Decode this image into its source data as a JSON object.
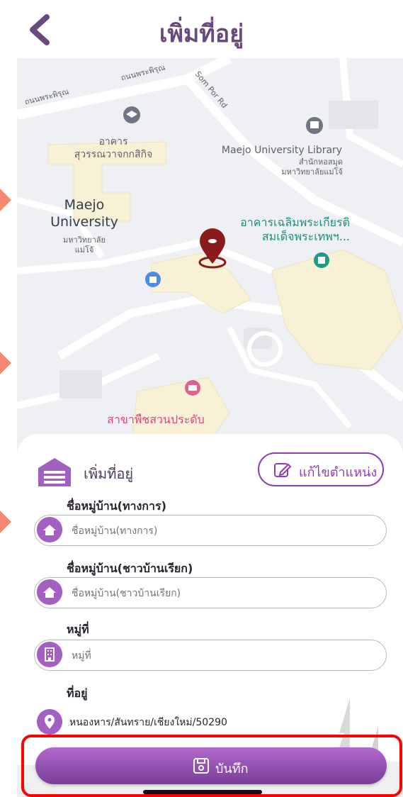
{
  "header": {
    "title": "เพิ่มที่อยู่"
  },
  "map": {
    "labels": {
      "road_1": "ถนนพระพิรุณ",
      "road_2": "ถนนพระพิรุณ",
      "road_3": "Som Por Rd",
      "building_1": "อาคาร\nสุวรรณวาจกกสิกิจ",
      "library": "Maejo University Library",
      "library_th": "สำนักหอสมุด\nมหาวิทยาลัยแม่โจ้",
      "university": "Maejo\nUniversity",
      "university_th": "มหาวิทยาลัย\nแม่โจ้",
      "building_2": "อาคารเฉลิมพระเกียรติ\nสมเด็จพระเทพฯ...",
      "poi_pink": "สาขาพืชสวนประดับ"
    }
  },
  "form": {
    "section_title": "เพิ่มที่อยู่",
    "edit_location_label": "แก้ไขตำแหน่ง",
    "fields": [
      {
        "label": "ชื่อหมู่บ้าน(ทางการ)",
        "placeholder": "ชื่อหมู่บ้าน(ทางการ)",
        "value": ""
      },
      {
        "label": "ชื่อหมู่บ้าน(ชาวบ้านเรียก)",
        "placeholder": "ชื่อหมู่บ้าน(ชาวบ้านเรียก)",
        "value": ""
      },
      {
        "label": "หมู่ที่",
        "placeholder": "หมู่ที่",
        "value": ""
      }
    ],
    "address_label": "ที่อยู่",
    "address_value": "หนองหาร/สันทราย/เชียงใหม่/50290",
    "save_label": "บันทึก"
  },
  "colors": {
    "accent": "#8e3fb0",
    "title": "#6a4a7c",
    "pin": "#8b1a1a"
  }
}
